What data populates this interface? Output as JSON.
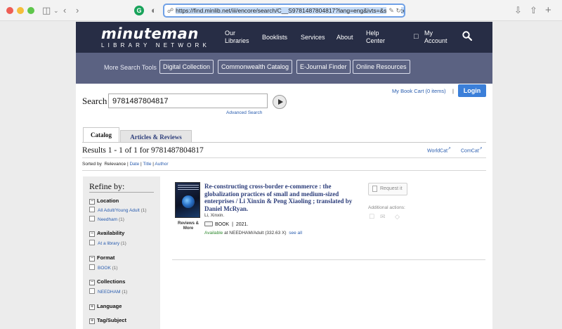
{
  "browser": {
    "url": "https://find.minlib.net/iii/encore/search/C__S9781487804817?lang=eng&ivts=&suite=cobalt",
    "traffic_colors": [
      "#ee5e55",
      "#f5be3b",
      "#5ec64b"
    ],
    "icons": [
      "sidebar-icon",
      "chevron-down-icon",
      "back-icon",
      "forward-icon",
      "grammarly-icon",
      "shield-icon",
      "translate-icon",
      "reload-icon",
      "download-icon",
      "share-icon",
      "new-tab-icon"
    ]
  },
  "header": {
    "logo_main": "minuteman",
    "logo_sub": "LIBRARY NETWORK",
    "nav": [
      {
        "line1": "Our",
        "line2": "Libraries"
      },
      {
        "line1": "Booklists",
        "line2": ""
      },
      {
        "line1": "Services",
        "line2": ""
      },
      {
        "line1": "About",
        "line2": ""
      },
      {
        "line1": "Help",
        "line2": "Center"
      },
      {
        "line1": "My",
        "line2": "Account"
      }
    ],
    "account_icon": "lock-icon",
    "search_icon": "search-icon",
    "colors": {
      "bar": "#272d45",
      "subbar": "#5b6282"
    }
  },
  "subnav": {
    "label": "More Search Tools",
    "buttons": [
      "Digital Collection",
      "Commonwealth Catalog",
      "E-Journal Finder",
      "Online Resources"
    ]
  },
  "account": {
    "cart": "My Book Cart (0 items)",
    "separator": "|",
    "login": "Login"
  },
  "search": {
    "label": "Search",
    "value": "9781487804817",
    "advanced": "Advanced Search"
  },
  "tabs": [
    "Catalog",
    "Articles & Reviews"
  ],
  "results": {
    "count_text": "Results 1 - 1 of 1 for 9781487804817",
    "worldcat": "WorldCat",
    "comcat": "ComCat",
    "sorted_by": "Sorted by",
    "sort_options": [
      "Relevance",
      "Date",
      "Title",
      "Author"
    ]
  },
  "refine": {
    "title": "Refine by:",
    "facets": [
      {
        "name": "Location",
        "expanded": true,
        "items": [
          {
            "label": "All Adult/Young Adult",
            "count": "(1)"
          },
          {
            "label": "Needham",
            "count": "(1)"
          }
        ]
      },
      {
        "name": "Availability",
        "expanded": true,
        "items": [
          {
            "label": "At a library",
            "count": "(1)"
          }
        ]
      },
      {
        "name": "Format",
        "expanded": true,
        "items": [
          {
            "label": "BOOK",
            "count": "(1)"
          }
        ]
      },
      {
        "name": "Collections",
        "expanded": true,
        "items": [
          {
            "label": "NEEDHAM",
            "count": "(1)"
          }
        ]
      },
      {
        "name": "Language",
        "expanded": false,
        "items": []
      },
      {
        "name": "Tag/Subject",
        "expanded": false,
        "items": []
      }
    ]
  },
  "record": {
    "title": "Re-constructing cross-border e-commerce : the globalization practices of small and medium-sized enterprises / Li Xinxin & Peng Xiaoling ; translated by Daniel McRyan.",
    "author": "Li, Xinxin.",
    "format": "BOOK",
    "year": "2021.",
    "reviews": "Reviews & More",
    "available_label": "Available",
    "available_at": "at NEEDHAM/Adult (332.63 X)",
    "see_all": "see all",
    "request": "Request it",
    "additional_actions": "Additional actions:",
    "action_icons": [
      "cart-icon",
      "email-icon",
      "tag-icon"
    ]
  }
}
